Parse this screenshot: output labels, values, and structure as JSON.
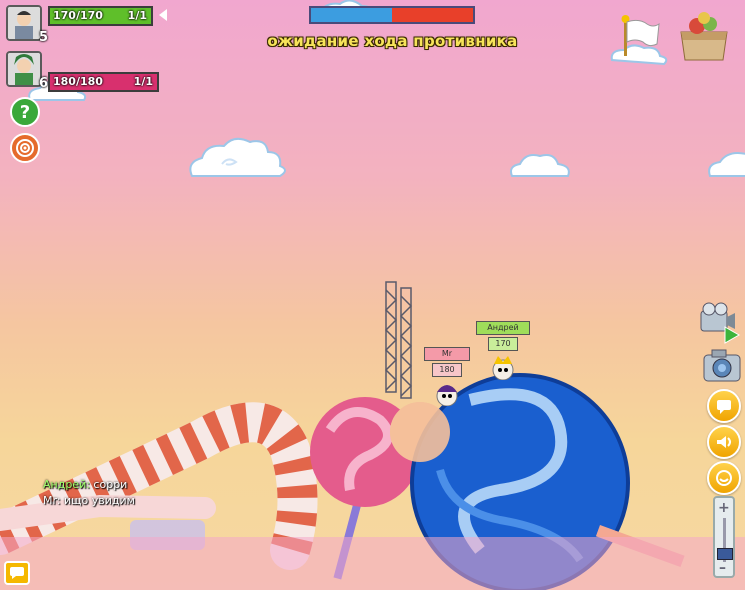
{
  "players": [
    {
      "level": "5",
      "hp_text": "170/170",
      "count": "1/1",
      "hp_fraction": 1.0,
      "bar_color": "#5fbf2a"
    },
    {
      "level": "6",
      "hp_text": "180/180",
      "count": "1/1",
      "hp_fraction": 1.0,
      "bar_color": "#d8306e"
    }
  ],
  "turn_meter": {
    "blue_fraction": 0.5,
    "blue_color": "#3c9de0",
    "red_color": "#e8402a"
  },
  "status_text": "ожидание хода противника",
  "characters": [
    {
      "name": "Mr",
      "hp": "180",
      "plate_color": "#f49aa8",
      "hp_color": "#f7c6c9"
    },
    {
      "name": "Андрей",
      "hp": "170",
      "plate_color": "#9fdd5a",
      "hp_color": "#c9ee9a"
    }
  ],
  "chat": [
    {
      "name": "Андрей:",
      "message": " сорри"
    },
    {
      "name": "Mr:",
      "message": " ищо увидим"
    }
  ],
  "icons": {
    "help": "question-icon",
    "target": "target-icon",
    "camera_video": "video-camera-icon",
    "camera_photo": "photo-camera-icon",
    "sound": "speaker-icon",
    "flag": "white-flag-icon",
    "box": "gift-box-icon",
    "chat": "chat-icon"
  },
  "colors": {
    "status": "#f7e45a",
    "side_button": "#f5b800"
  }
}
